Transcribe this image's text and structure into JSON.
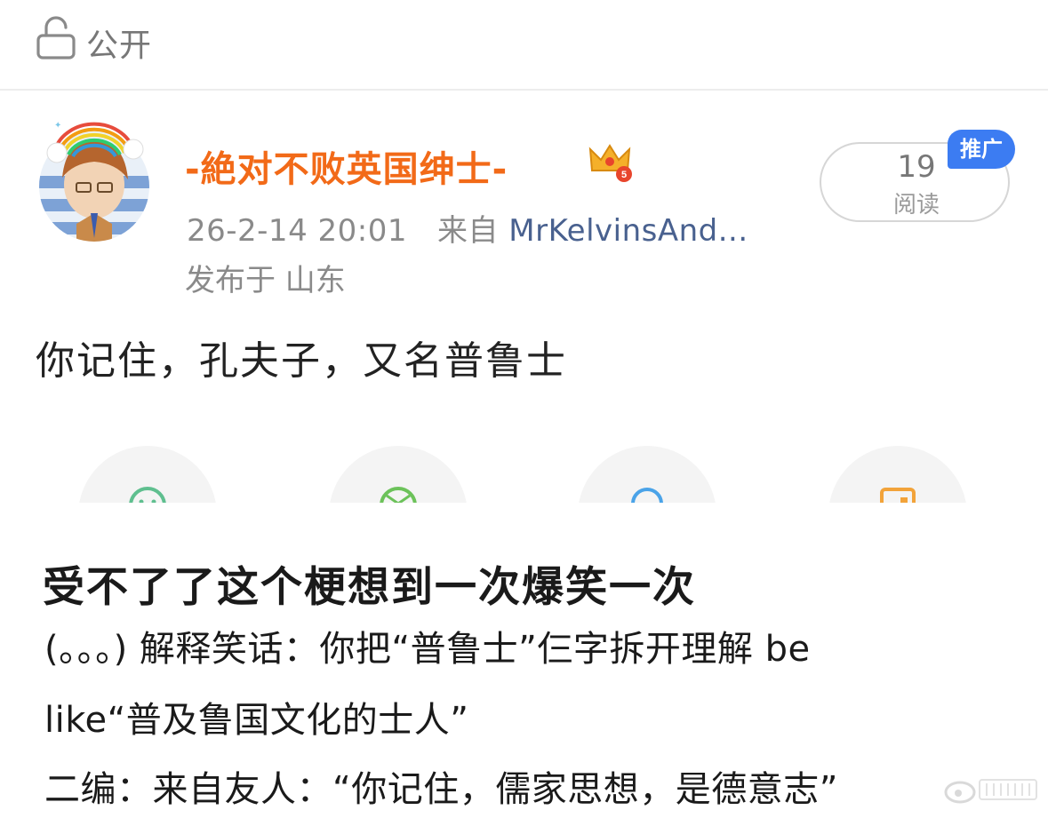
{
  "header": {
    "visibility_label": "公开"
  },
  "post": {
    "username": "-絶对不败英国绅士-",
    "crown_badge_level": "5",
    "timestamp": "26-2-14 20:01",
    "source_prefix": "来自",
    "source_app": "MrKelvinsAnd...",
    "location": "发布于 山东",
    "read_count": "19",
    "read_label": "阅读",
    "promo_tag": "推广",
    "text": "你记住，孔夫子，又名普鲁士"
  },
  "actions": [
    {
      "icon": "smile-icon",
      "color": "#5fbf8f"
    },
    {
      "icon": "aperture-icon",
      "color": "#6cc25a"
    },
    {
      "icon": "search-icon",
      "color": "#4aa3e8"
    },
    {
      "icon": "box-icon",
      "color": "#f2a33a"
    }
  ],
  "caption": {
    "title": "受不了了这个梗想到一次爆笑一次",
    "line1": "(。。。) 解释笑话：你把“普鲁士”仨字拆开理解 be",
    "line2": "like“普及鲁国文化的士人”",
    "line3": "二编：来自友人：“你记住，儒家思想，是德意志”"
  },
  "colors": {
    "username": "#f26a18",
    "source_link": "#49618f",
    "promo": "#3c7cf2"
  }
}
